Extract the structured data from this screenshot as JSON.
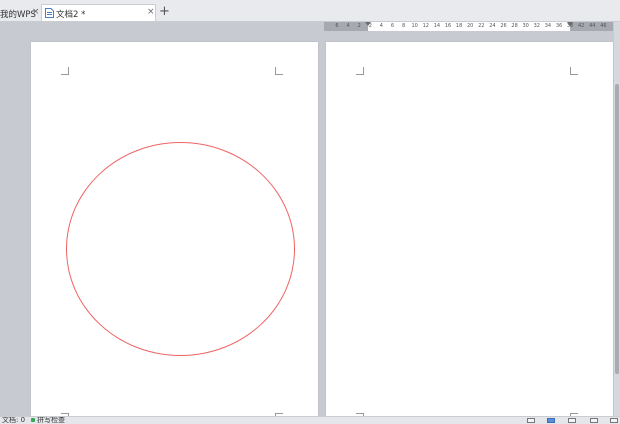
{
  "tabs": [
    {
      "label": "我的WPS",
      "close": "×"
    },
    {
      "label": "文档2 *",
      "close": "×"
    }
  ],
  "add_tab": "+",
  "ruler": {
    "labels": [
      "6",
      "4",
      "2",
      "2",
      "4",
      "6",
      "8",
      "10",
      "12",
      "14",
      "16",
      "18",
      "20",
      "22",
      "24",
      "26",
      "28",
      "30",
      "32",
      "34",
      "36",
      "38",
      "42",
      "44",
      "46"
    ]
  },
  "status": {
    "page_label": "文档: 0",
    "spell_check": "拼写检查"
  },
  "shape": {
    "type": "circle",
    "stroke_color": "#f06464"
  },
  "icons": {
    "doc_tab": "document-icon",
    "views": [
      "print-layout-icon",
      "full-screen-icon",
      "web-layout-icon",
      "outline-icon",
      "reading-mode-icon"
    ]
  }
}
